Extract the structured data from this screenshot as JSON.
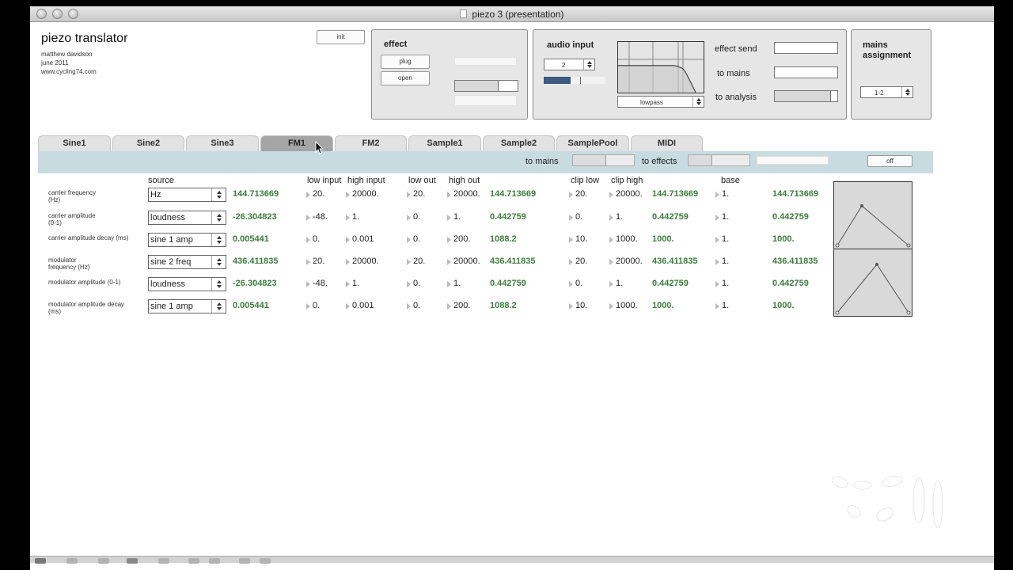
{
  "window": {
    "title": "piezo 3 (presentation)"
  },
  "header": {
    "title": "piezo translator",
    "author": "matthew davidson",
    "date": "june 2011",
    "url": "www.cycling74.com",
    "init_label": "init"
  },
  "effect": {
    "title": "effect",
    "plug_label": "plug",
    "open_label": "open",
    "level": 0.7
  },
  "audio_input": {
    "title": "audio input",
    "channel": "2",
    "filter_type": "lowpass",
    "effect_send_label": "effect send",
    "to_mains_label": "to mains",
    "to_analysis_label": "to analysis",
    "to_analysis_level": 0.9
  },
  "mains": {
    "title_line1": "mains",
    "title_line2": "assignment",
    "value": "1-2"
  },
  "tabs": [
    "Sine1",
    "Sine2",
    "Sine3",
    "FM1",
    "FM2",
    "Sample1",
    "Sample2",
    "SamplePool",
    "MIDI"
  ],
  "active_tab": "FM1",
  "strip": {
    "to_mains_label": "to mains",
    "to_effects_label": "to effects",
    "off_label": "off"
  },
  "columns": {
    "source": "source",
    "low_input": "low input",
    "high_input": "high input",
    "low_out": "low out",
    "high_out": "high out",
    "clip_low": "clip low",
    "clip_high": "clip high",
    "base": "base"
  },
  "rows": [
    {
      "label1": "carrier frequency",
      "label2": "(Hz)",
      "source": "Hz",
      "input_value": "144.713669",
      "low_in": "20.",
      "high_in": "20000.",
      "low_out": "20.",
      "high_out": "20000.",
      "scaled": "144.713669",
      "clip_low": "20.",
      "clip_high": "20000.",
      "clipped": "144.713669",
      "base": "1.",
      "output": "144.713669"
    },
    {
      "label1": "carrier amplitude",
      "label2": "(0-1)",
      "source": "loudness",
      "input_value": "-26.304823",
      "low_in": "-48.",
      "high_in": "1.",
      "low_out": "0.",
      "high_out": "1.",
      "scaled": "0.442759",
      "clip_low": "0.",
      "clip_high": "1.",
      "clipped": "0.442759",
      "base": "1.",
      "output": "0.442759"
    },
    {
      "label1": "carrier amplitude decay (ms)",
      "label2": "",
      "source": "sine 1 amp",
      "input_value": "0.005441",
      "low_in": "0.",
      "high_in": "0.001",
      "low_out": "0.",
      "high_out": "200.",
      "scaled": "1088.2",
      "clip_low": "10.",
      "clip_high": "1000.",
      "clipped": "1000.",
      "base": "1.",
      "output": "1000."
    },
    {
      "label1": "modulator",
      "label2": "frequency (Hz)",
      "source": "sine 2 freq",
      "input_value": "436.411835",
      "low_in": "20.",
      "high_in": "20000.",
      "low_out": "20.",
      "high_out": "20000.",
      "scaled": "436.411835",
      "clip_low": "20.",
      "clip_high": "20000.",
      "clipped": "436.411835",
      "base": "1.",
      "output": "436.411835"
    },
    {
      "label1": "modulator amplitude (0-1)",
      "label2": "",
      "source": "loudness",
      "input_value": "-26.304823",
      "low_in": "-48.",
      "high_in": "1.",
      "low_out": "0.",
      "high_out": "1.",
      "scaled": "0.442759",
      "clip_low": "0.",
      "clip_high": "1.",
      "clipped": "0.442759",
      "base": "1.",
      "output": "0.442759"
    },
    {
      "label1": "modulator amplitude decay",
      "label2": "(ms)",
      "source": "sine 1 amp",
      "input_value": "0.005441",
      "low_in": "0.",
      "high_in": "0.001",
      "low_out": "0.",
      "high_out": "200.",
      "scaled": "1088.2",
      "clip_low": "10.",
      "clip_high": "1000.",
      "clipped": "1000.",
      "base": "1.",
      "output": "1000."
    }
  ],
  "colors": {
    "value_green": "#3b7e3b",
    "tab_strip": "#c8dbe0",
    "active_tab": "#a5a5a5",
    "level_blue": "#3d5a80"
  },
  "icons": [
    "window-close-icon",
    "window-minimize-icon",
    "window-zoom-icon",
    "document-icon",
    "dropdown-arrows-icon",
    "number-box-arrow-icon",
    "filter-response-graph",
    "envelope-graph",
    "cycling74-watermark-logo"
  ]
}
